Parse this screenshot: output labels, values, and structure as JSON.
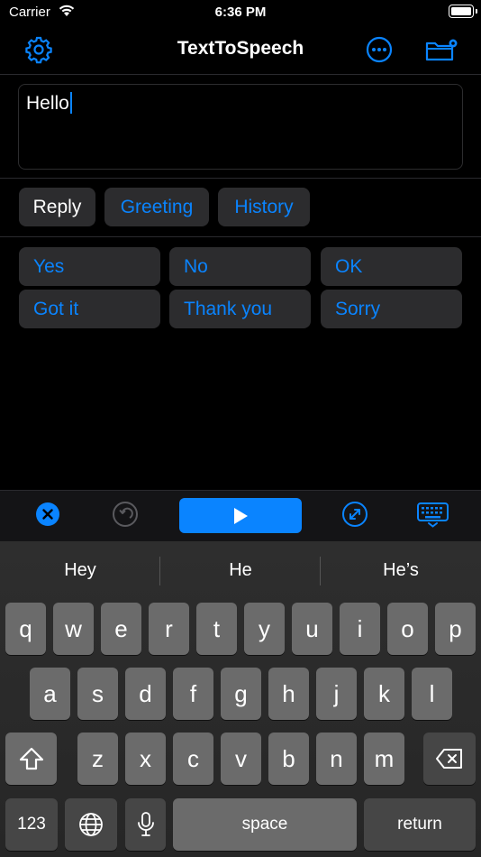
{
  "status": {
    "carrier": "Carrier",
    "time": "6:36 PM"
  },
  "nav": {
    "title": "TextToSpeech"
  },
  "editor": {
    "text": "Hello"
  },
  "tabs": [
    {
      "label": "Reply",
      "active": true
    },
    {
      "label": "Greeting",
      "active": false
    },
    {
      "label": "History",
      "active": false
    }
  ],
  "phrases": [
    "Yes",
    "No",
    "OK",
    "Got it",
    "Thank you",
    "Sorry"
  ],
  "toolbar": {
    "icons": [
      "clear-icon",
      "undo-icon",
      "play-icon",
      "expand-icon",
      "keyboard-hide-icon"
    ]
  },
  "keyboard": {
    "suggestions": [
      "Hey",
      "He",
      "He’s"
    ],
    "row1": [
      "q",
      "w",
      "e",
      "r",
      "t",
      "y",
      "u",
      "i",
      "o",
      "p"
    ],
    "row2": [
      "a",
      "s",
      "d",
      "f",
      "g",
      "h",
      "j",
      "k",
      "l"
    ],
    "row3": [
      "z",
      "x",
      "c",
      "v",
      "b",
      "n",
      "m"
    ],
    "numbers": "123",
    "space": "space",
    "return": "return"
  },
  "colors": {
    "accent": "#0a84ff",
    "background": "#000000",
    "button": "#2c2c2e"
  }
}
